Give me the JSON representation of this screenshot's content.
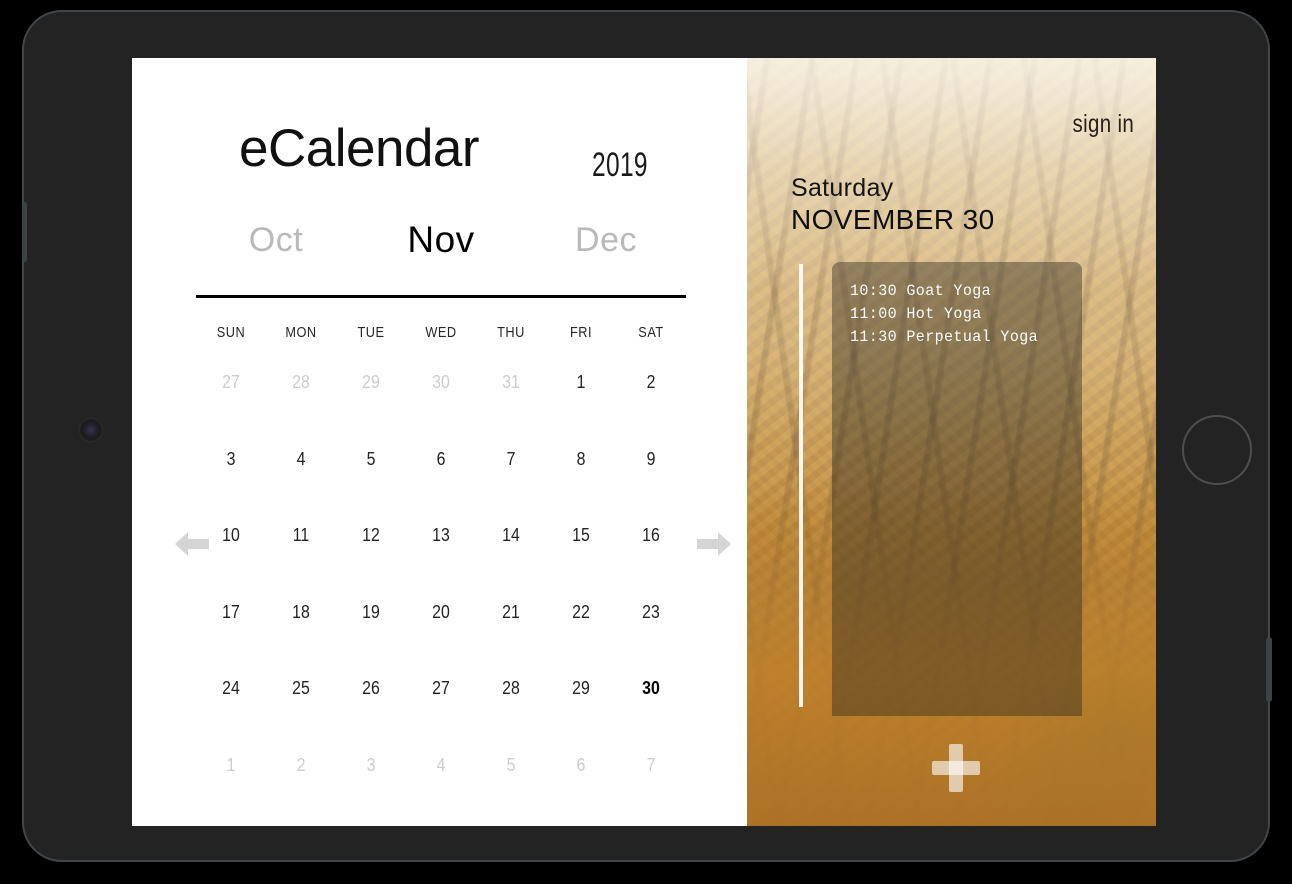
{
  "device": {
    "type": "tablet",
    "camera_icon": "camera-lens-icon",
    "home_button_icon": "home-button-icon"
  },
  "app": {
    "title": "eCalendar",
    "year": "2019"
  },
  "months": {
    "previous": "Oct",
    "current": "Nov",
    "next": "Dec"
  },
  "nav": {
    "prev_arrow_icon": "arrow-left-icon",
    "next_arrow_icon": "arrow-right-icon",
    "arrow_color": "#d5d5d5"
  },
  "weekdays": [
    "SUN",
    "MON",
    "TUE",
    "WED",
    "THU",
    "FRI",
    "SAT"
  ],
  "calendar": {
    "weeks": [
      [
        {
          "day": "27",
          "muted": true,
          "selected": false
        },
        {
          "day": "28",
          "muted": true,
          "selected": false
        },
        {
          "day": "29",
          "muted": true,
          "selected": false
        },
        {
          "day": "30",
          "muted": true,
          "selected": false
        },
        {
          "day": "31",
          "muted": true,
          "selected": false
        },
        {
          "day": "1",
          "muted": false,
          "selected": false
        },
        {
          "day": "2",
          "muted": false,
          "selected": false
        }
      ],
      [
        {
          "day": "3",
          "muted": false,
          "selected": false
        },
        {
          "day": "4",
          "muted": false,
          "selected": false
        },
        {
          "day": "5",
          "muted": false,
          "selected": false
        },
        {
          "day": "6",
          "muted": false,
          "selected": false
        },
        {
          "day": "7",
          "muted": false,
          "selected": false
        },
        {
          "day": "8",
          "muted": false,
          "selected": false
        },
        {
          "day": "9",
          "muted": false,
          "selected": false
        }
      ],
      [
        {
          "day": "10",
          "muted": false,
          "selected": false
        },
        {
          "day": "11",
          "muted": false,
          "selected": false
        },
        {
          "day": "12",
          "muted": false,
          "selected": false
        },
        {
          "day": "13",
          "muted": false,
          "selected": false
        },
        {
          "day": "14",
          "muted": false,
          "selected": false
        },
        {
          "day": "15",
          "muted": false,
          "selected": false
        },
        {
          "day": "16",
          "muted": false,
          "selected": false
        }
      ],
      [
        {
          "day": "17",
          "muted": false,
          "selected": false
        },
        {
          "day": "18",
          "muted": false,
          "selected": false
        },
        {
          "day": "19",
          "muted": false,
          "selected": false
        },
        {
          "day": "20",
          "muted": false,
          "selected": false
        },
        {
          "day": "21",
          "muted": false,
          "selected": false
        },
        {
          "day": "22",
          "muted": false,
          "selected": false
        },
        {
          "day": "23",
          "muted": false,
          "selected": false
        }
      ],
      [
        {
          "day": "24",
          "muted": false,
          "selected": false
        },
        {
          "day": "25",
          "muted": false,
          "selected": false
        },
        {
          "day": "26",
          "muted": false,
          "selected": false
        },
        {
          "day": "27",
          "muted": false,
          "selected": false
        },
        {
          "day": "28",
          "muted": false,
          "selected": false
        },
        {
          "day": "29",
          "muted": false,
          "selected": false
        },
        {
          "day": "30",
          "muted": false,
          "selected": true
        }
      ],
      [
        {
          "day": "1",
          "muted": true,
          "selected": false
        },
        {
          "day": "2",
          "muted": true,
          "selected": false
        },
        {
          "day": "3",
          "muted": true,
          "selected": false
        },
        {
          "day": "4",
          "muted": true,
          "selected": false
        },
        {
          "day": "5",
          "muted": true,
          "selected": false
        },
        {
          "day": "6",
          "muted": true,
          "selected": false
        },
        {
          "day": "7",
          "muted": true,
          "selected": false
        }
      ]
    ]
  },
  "detail_panel": {
    "sign_in_label": "sign in",
    "day_name": "Saturday",
    "full_date": "NOVEMBER 30",
    "events": [
      "10:30 Goat Yoga",
      "11:00 Hot Yoga",
      "11:30 Perpetual Yoga"
    ],
    "add_event_icon": "plus-icon",
    "background_image": "autumn-forest-photo"
  }
}
